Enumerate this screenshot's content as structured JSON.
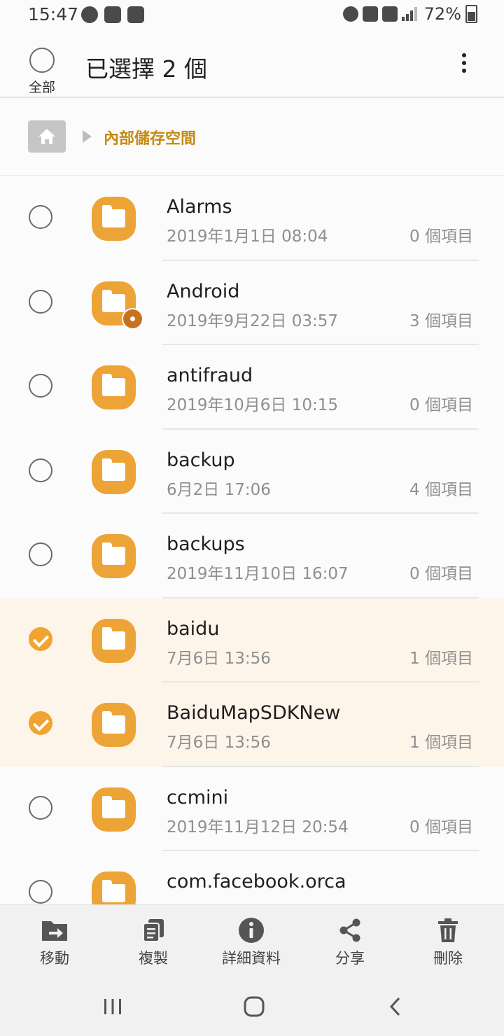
{
  "status_bar": {
    "time": "15:47",
    "battery": "72%",
    "icons_left": [
      "line-icon",
      "news-icon",
      "wifi-icon"
    ],
    "icons_right": [
      "alarm-icon",
      "mute-icon",
      "4g-icon",
      "signal-icon",
      "battery-icon"
    ]
  },
  "appbar": {
    "select_all_label": "全部",
    "title": "已選擇 2 個",
    "more_icon": "more-vertical-icon"
  },
  "breadcrumb": {
    "home_icon": "home-icon",
    "path": "內部儲存空間"
  },
  "colors": {
    "accent": "#f0a431",
    "folder": "#eda436",
    "path_text": "#c58a12",
    "selected_row_bg": "#fdf5ea"
  },
  "files": [
    {
      "name": "Alarms",
      "date": "2019年1月1日 08:04",
      "count": "0 個項目",
      "selected": false
    },
    {
      "name": "Android",
      "date": "2019年9月22日 03:57",
      "count": "3 個項目",
      "selected": false,
      "badge": "gear-icon"
    },
    {
      "name": "antifraud",
      "date": "2019年10月6日 10:15",
      "count": "0 個項目",
      "selected": false
    },
    {
      "name": "backup",
      "date": "6月2日 17:06",
      "count": "4 個項目",
      "selected": false
    },
    {
      "name": "backups",
      "date": "2019年11月10日 16:07",
      "count": "0 個項目",
      "selected": false
    },
    {
      "name": "baidu",
      "date": "7月6日 13:56",
      "count": "1 個項目",
      "selected": true
    },
    {
      "name": "BaiduMapSDKNew",
      "date": "7月6日 13:56",
      "count": "1 個項目",
      "selected": true
    },
    {
      "name": "ccmini",
      "date": "2019年11月12日 20:54",
      "count": "0 個項目",
      "selected": false
    },
    {
      "name": "com.facebook.orca",
      "date": "",
      "count": "",
      "selected": false
    }
  ],
  "actions": [
    {
      "label": "移動",
      "icon": "move-icon"
    },
    {
      "label": "複製",
      "icon": "copy-icon"
    },
    {
      "label": "詳細資料",
      "icon": "info-icon"
    },
    {
      "label": "分享",
      "icon": "share-icon"
    },
    {
      "label": "刪除",
      "icon": "trash-icon"
    }
  ],
  "navbar": {
    "recents_icon": "recents-icon",
    "home_icon": "home-circle-icon",
    "back_icon": "back-icon"
  }
}
